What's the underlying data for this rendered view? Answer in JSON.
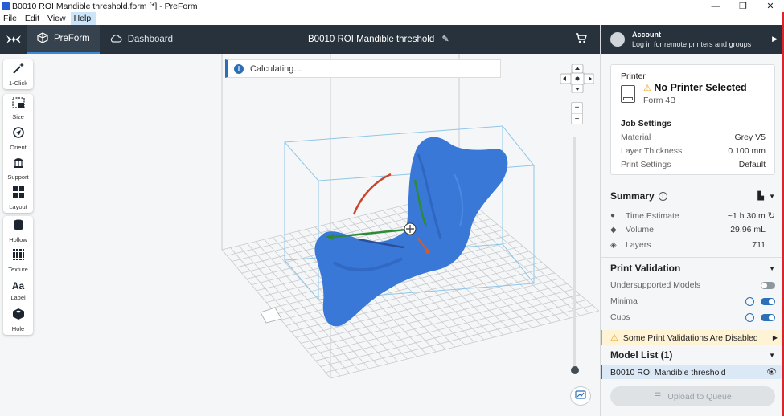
{
  "window": {
    "title": "B0010 ROI Mandible threshold.form [*] - PreForm",
    "minimize": "—",
    "maximize": "❐",
    "close": "✕"
  },
  "menu": {
    "items": [
      "File",
      "Edit",
      "View",
      "Help"
    ]
  },
  "header": {
    "tabs": [
      {
        "label": "PreForm",
        "icon": "preform-icon"
      },
      {
        "label": "Dashboard",
        "icon": "cloud-icon"
      }
    ],
    "document_title": "B0010 ROI Mandible threshold"
  },
  "account": {
    "title": "Account",
    "subtitle": "Log in for remote printers and groups"
  },
  "tools": {
    "group1": [
      {
        "label": "1-Click",
        "icon": "magic-wand-icon"
      }
    ],
    "group2": [
      {
        "label": "Size",
        "icon": "resize-icon"
      },
      {
        "label": "Orient",
        "icon": "orient-icon"
      },
      {
        "label": "Support",
        "icon": "support-icon"
      },
      {
        "label": "Layout",
        "icon": "layout-icon"
      }
    ],
    "group3": [
      {
        "label": "Hollow",
        "icon": "hollow-icon"
      },
      {
        "label": "Texture",
        "icon": "texture-icon"
      },
      {
        "label": "Label",
        "icon": "label-icon"
      },
      {
        "label": "Hole",
        "icon": "hole-icon"
      }
    ]
  },
  "viewport": {
    "status": "Calculating...",
    "zoom_in": "+",
    "zoom_out": "−"
  },
  "printer": {
    "section_label": "Printer",
    "name": "No Printer Selected",
    "model": "Form 4B",
    "job_settings_title": "Job Settings",
    "job_settings": [
      {
        "label": "Material",
        "value": "Grey V5"
      },
      {
        "label": "Layer Thickness",
        "value": "0.100 mm"
      },
      {
        "label": "Print Settings",
        "value": "Default"
      }
    ]
  },
  "summary": {
    "title": "Summary",
    "rows": [
      {
        "label": "Time Estimate",
        "value": "~1 h 30 m",
        "icon": "clock-icon"
      },
      {
        "label": "Volume",
        "value": "29.96 mL",
        "icon": "volume-icon"
      },
      {
        "label": "Layers",
        "value": "711",
        "icon": "layers-icon"
      }
    ]
  },
  "validation": {
    "title": "Print Validation",
    "rows": [
      {
        "label": "Undersupported Models",
        "enabled": false
      },
      {
        "label": "Minima",
        "enabled": true
      },
      {
        "label": "Cups",
        "enabled": true
      }
    ],
    "warning": "Some Print Validations Are Disabled"
  },
  "models": {
    "title": "Model List (1)",
    "items": [
      "B0010 ROI Mandible threshold"
    ]
  },
  "upload_button": "Upload to Queue",
  "colors": {
    "header_bg": "#27323c",
    "accent": "#2c6fb7",
    "model": "#3a78d8",
    "warning": "#e9a21a"
  }
}
